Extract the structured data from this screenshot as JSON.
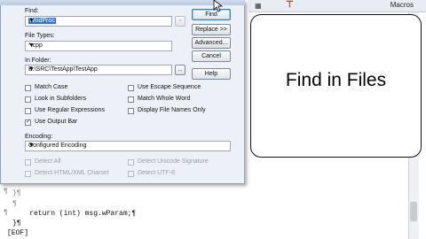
{
  "editor": {
    "toolbar": {
      "macros_label": "Macros",
      "glyph": "▦",
      "cursor_marker": "⊤"
    },
    "lines": [
      {
        "gutter": "}¶",
        "text": ""
      },
      {
        "gutter": "¶",
        "text": ""
      },
      {
        "gutter": "",
        "text": "    return (int) msg.wParam;¶"
      },
      {
        "gutter": "",
        "text": "}¶"
      },
      {
        "gutter": "",
        "text": "[EOF]"
      }
    ]
  },
  "dialog": {
    "find_label": "Find:",
    "find_value": "WndProc",
    "find_options_glyph": ">",
    "file_types_label": "File Types:",
    "file_types_value": "*.cpp",
    "in_folder_label": "In Folder:",
    "in_folder_value": "E:\\SRC\\TestApp\\TestApp",
    "browse_label": "...",
    "buttons": {
      "find": "Find",
      "replace": "Replace >>",
      "advanced": "Advanced...",
      "cancel": "Cancel",
      "help": "Help"
    },
    "checkboxes_left": [
      {
        "label": "Match Case",
        "checked": false
      },
      {
        "label": "Look in Subfolders",
        "checked": false
      },
      {
        "label": "Use Regular Expressions",
        "checked": false
      },
      {
        "label": "Use Output Bar",
        "checked": true
      }
    ],
    "checkboxes_right": [
      {
        "label": "Use Escape Sequence",
        "checked": false
      },
      {
        "label": "Match Whole Word",
        "checked": false
      },
      {
        "label": "Display File Names Only",
        "checked": false
      }
    ],
    "encoding_label": "Encoding:",
    "encoding_value": "Configured Encoding",
    "encoding_options": [
      {
        "label": "Detect All",
        "checked": false
      },
      {
        "label": "Detect Unicode Signature",
        "checked": false
      },
      {
        "label": "Detect HTML/XML Charset",
        "checked": false
      },
      {
        "label": "Detect UTF-8",
        "checked": false
      }
    ]
  },
  "callout": {
    "text": "Find in Files"
  }
}
